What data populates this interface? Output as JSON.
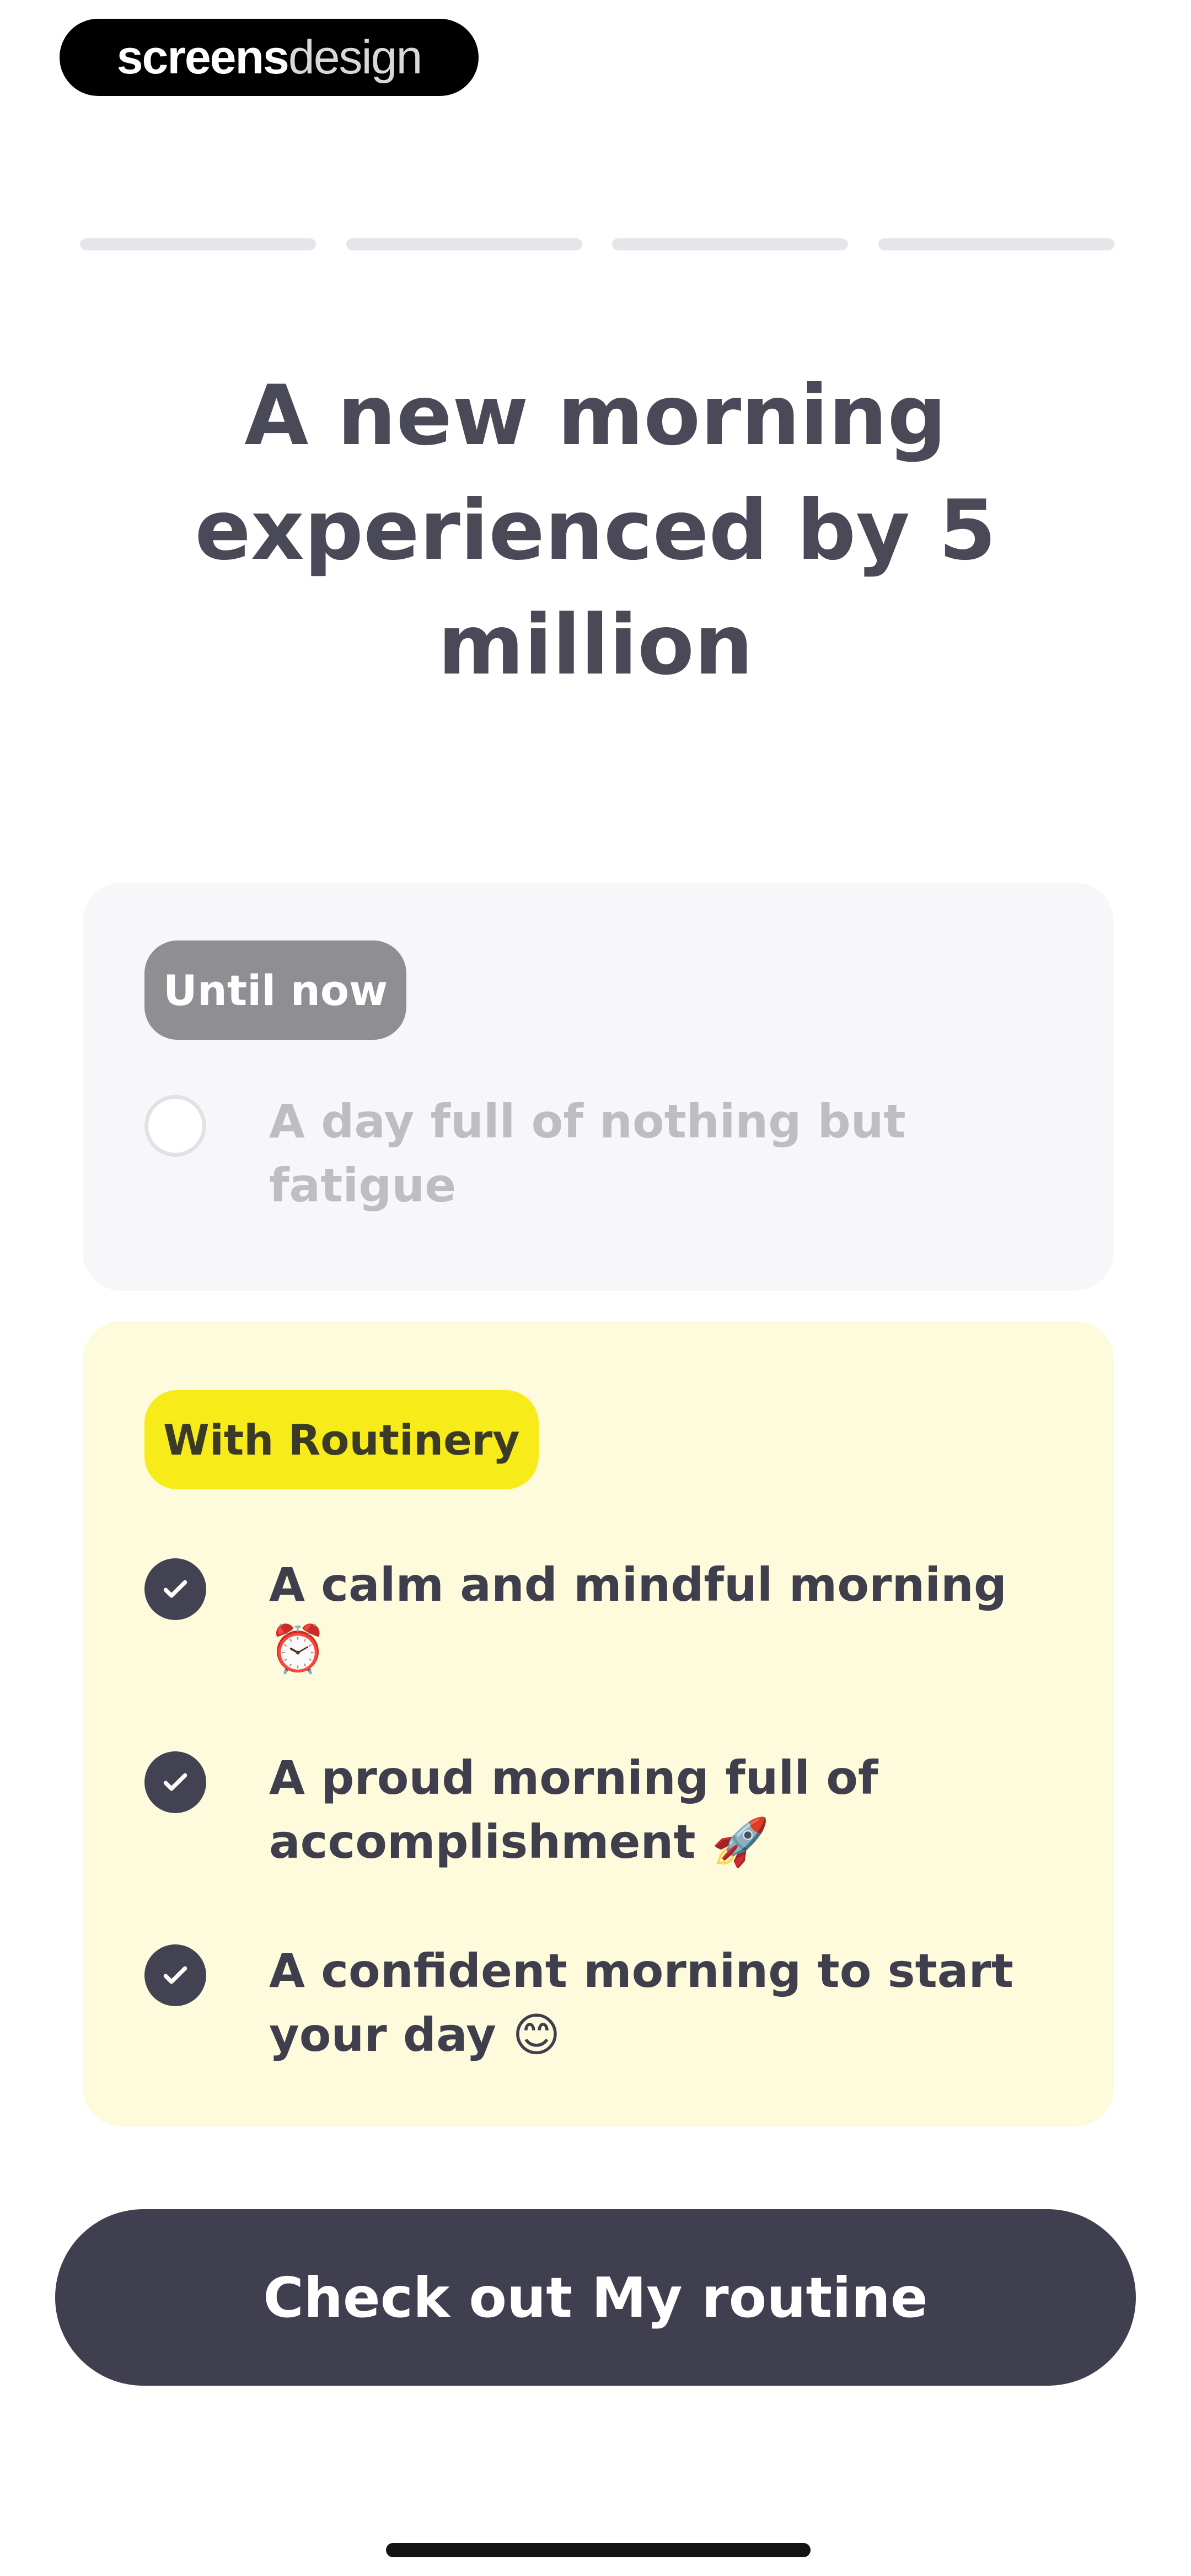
{
  "watermark": {
    "bold_part": "screens",
    "light_part": "design"
  },
  "progress": {
    "segments": [
      {
        "filled_fraction": 0
      },
      {
        "filled_fraction": 0
      },
      {
        "filled_fraction": 0
      },
      {
        "filled_fraction": 0
      }
    ],
    "active_color": "#3f3e4d",
    "track_color": "#e6e6ea"
  },
  "headline": "A new morning experienced by 5 million",
  "before_card": {
    "tag": "Until now",
    "items": [
      {
        "text": "A day full of nothing but fatigue",
        "checked": false
      }
    ]
  },
  "after_card": {
    "tag": "With Routinery",
    "tag_color": "#f7ec1a",
    "items": [
      {
        "text": "A calm and mindful morning ⏰",
        "checked": true
      },
      {
        "text": "A proud morning full of accomplishment 🚀",
        "checked": true
      },
      {
        "text": "A confident morning to start your day 😊",
        "checked": true
      }
    ]
  },
  "cta": {
    "label": "Check out My routine"
  },
  "icons": {
    "unchecked": "empty-circle-icon",
    "checked": "check-circle-icon"
  }
}
